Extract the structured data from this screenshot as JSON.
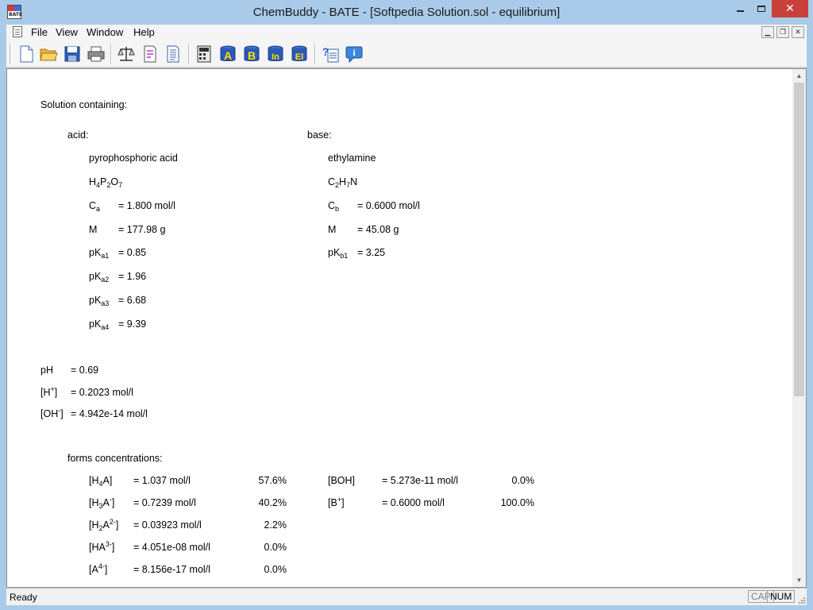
{
  "window": {
    "title": "ChemBuddy - BATE - [Softpedia Solution.sol - equilibrium]",
    "app_icon_label": "BATE"
  },
  "menu": {
    "items": [
      "File",
      "View",
      "Window",
      "Help"
    ]
  },
  "toolbar": {
    "buttons": [
      "new-icon",
      "open-icon",
      "save-icon",
      "print-icon",
      "balance-icon",
      "doc-properties-icon",
      "report-icon",
      "calculator-icon",
      "acid-db-icon",
      "base-db-icon",
      "indicator-db-icon",
      "element-db-icon",
      "help-context-icon",
      "about-icon"
    ],
    "db_letters": [
      "A",
      "B",
      "In",
      "El"
    ]
  },
  "document": {
    "heading": "Solution containing:",
    "acid": {
      "label": "acid:",
      "name": "pyrophosphoric acid",
      "formula_parts": [
        "H",
        "4",
        "P",
        "2",
        "O",
        "7"
      ],
      "c_label": "C",
      "c_sub": "a",
      "c_value": "= 1.800 mol/l",
      "m_label": "M",
      "m_value": "= 177.98 g",
      "pk": [
        {
          "label": "pK",
          "sub": "a1",
          "value": "= 0.85"
        },
        {
          "label": "pK",
          "sub": "a2",
          "value": "= 1.96"
        },
        {
          "label": "pK",
          "sub": "a3",
          "value": "= 6.68"
        },
        {
          "label": "pK",
          "sub": "a4",
          "value": "= 9.39"
        }
      ]
    },
    "base": {
      "label": "base:",
      "name": "ethylamine",
      "formula_parts": [
        "C",
        "2",
        "H",
        "7",
        "N"
      ],
      "c_label": "C",
      "c_sub": "b",
      "c_value": "= 0.6000 mol/l",
      "m_label": "M",
      "m_value": "= 45.08 g",
      "pk": [
        {
          "label": "pK",
          "sub": "b1",
          "value": "= 3.25"
        }
      ]
    },
    "results": {
      "ph_label": "pH",
      "ph_value": "= 0.69",
      "h_label": "[H",
      "h_sup": "+",
      "h_close": "]",
      "h_value": "= 0.2023 mol/l",
      "oh_label": "[OH",
      "oh_sup": "-",
      "oh_close": "]",
      "oh_value": "= 4.942e-14 mol/l"
    },
    "forms": {
      "label": "forms concentrations:",
      "acid_forms": [
        {
          "value": "= 1.037 mol/l",
          "pct": "57.6%"
        },
        {
          "value": "= 0.7239 mol/l",
          "pct": "40.2%"
        },
        {
          "value": "= 0.03923 mol/l",
          "pct": "2.2%"
        },
        {
          "value": "= 4.051e-08 mol/l",
          "pct": "0.0%"
        },
        {
          "value": "= 8.156e-17 mol/l",
          "pct": "0.0%"
        }
      ],
      "base_forms": [
        {
          "name": "[BOH]",
          "value": "= 5.273e-11 mol/l",
          "pct": "0.0%"
        },
        {
          "name_prefix": "[B",
          "name_sup": "+",
          "name_suffix": "]",
          "value": "= 0.6000 mol/l",
          "pct": "100.0%"
        }
      ]
    }
  },
  "status": {
    "text": "Ready",
    "cap": "CAP",
    "num": "NUM"
  }
}
